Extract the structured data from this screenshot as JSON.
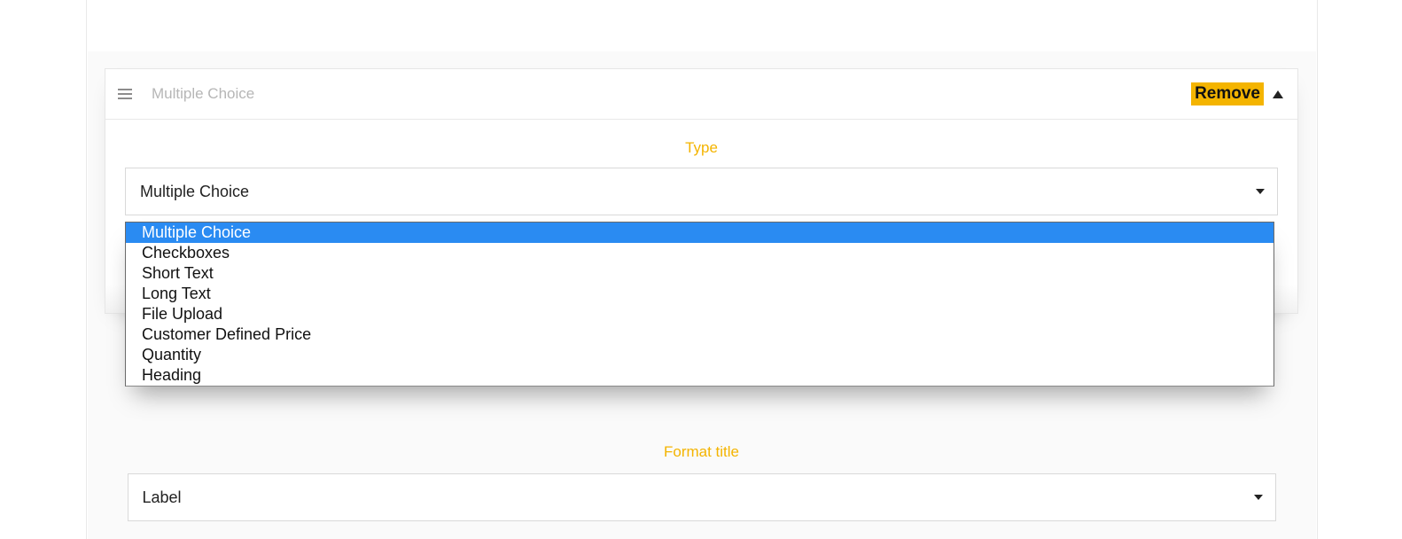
{
  "panel": {
    "header_title": "Multiple Choice",
    "remove_label": "Remove"
  },
  "type_section": {
    "label": "Type",
    "selected": "Multiple Choice",
    "options": [
      "Multiple Choice",
      "Checkboxes",
      "Short Text",
      "Long Text",
      "File Upload",
      "Customer Defined Price",
      "Quantity",
      "Heading"
    ],
    "selected_index": 0
  },
  "format_section": {
    "label": "Format title",
    "selected": "Label"
  }
}
